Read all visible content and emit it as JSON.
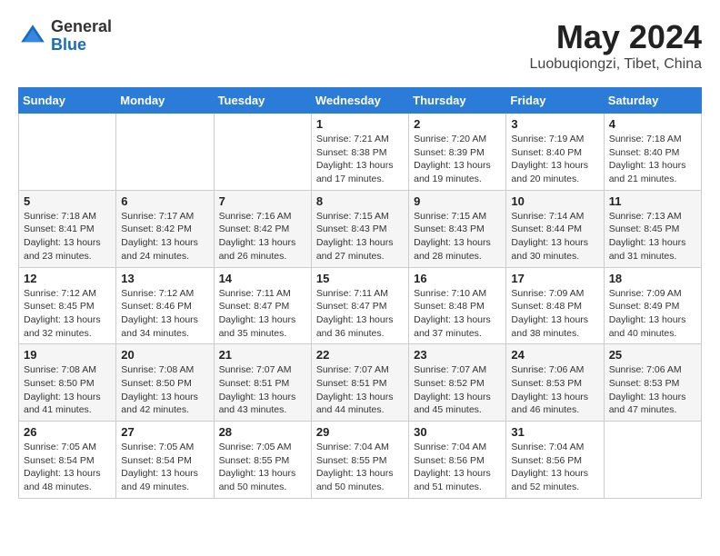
{
  "header": {
    "logo_general": "General",
    "logo_blue": "Blue",
    "month_year": "May 2024",
    "location": "Luobuqiongzi, Tibet, China"
  },
  "weekdays": [
    "Sunday",
    "Monday",
    "Tuesday",
    "Wednesday",
    "Thursday",
    "Friday",
    "Saturday"
  ],
  "weeks": [
    [
      {
        "day": "",
        "info": ""
      },
      {
        "day": "",
        "info": ""
      },
      {
        "day": "",
        "info": ""
      },
      {
        "day": "1",
        "info": "Sunrise: 7:21 AM\nSunset: 8:38 PM\nDaylight: 13 hours\nand 17 minutes."
      },
      {
        "day": "2",
        "info": "Sunrise: 7:20 AM\nSunset: 8:39 PM\nDaylight: 13 hours\nand 19 minutes."
      },
      {
        "day": "3",
        "info": "Sunrise: 7:19 AM\nSunset: 8:40 PM\nDaylight: 13 hours\nand 20 minutes."
      },
      {
        "day": "4",
        "info": "Sunrise: 7:18 AM\nSunset: 8:40 PM\nDaylight: 13 hours\nand 21 minutes."
      }
    ],
    [
      {
        "day": "5",
        "info": "Sunrise: 7:18 AM\nSunset: 8:41 PM\nDaylight: 13 hours\nand 23 minutes."
      },
      {
        "day": "6",
        "info": "Sunrise: 7:17 AM\nSunset: 8:42 PM\nDaylight: 13 hours\nand 24 minutes."
      },
      {
        "day": "7",
        "info": "Sunrise: 7:16 AM\nSunset: 8:42 PM\nDaylight: 13 hours\nand 26 minutes."
      },
      {
        "day": "8",
        "info": "Sunrise: 7:15 AM\nSunset: 8:43 PM\nDaylight: 13 hours\nand 27 minutes."
      },
      {
        "day": "9",
        "info": "Sunrise: 7:15 AM\nSunset: 8:43 PM\nDaylight: 13 hours\nand 28 minutes."
      },
      {
        "day": "10",
        "info": "Sunrise: 7:14 AM\nSunset: 8:44 PM\nDaylight: 13 hours\nand 30 minutes."
      },
      {
        "day": "11",
        "info": "Sunrise: 7:13 AM\nSunset: 8:45 PM\nDaylight: 13 hours\nand 31 minutes."
      }
    ],
    [
      {
        "day": "12",
        "info": "Sunrise: 7:12 AM\nSunset: 8:45 PM\nDaylight: 13 hours\nand 32 minutes."
      },
      {
        "day": "13",
        "info": "Sunrise: 7:12 AM\nSunset: 8:46 PM\nDaylight: 13 hours\nand 34 minutes."
      },
      {
        "day": "14",
        "info": "Sunrise: 7:11 AM\nSunset: 8:47 PM\nDaylight: 13 hours\nand 35 minutes."
      },
      {
        "day": "15",
        "info": "Sunrise: 7:11 AM\nSunset: 8:47 PM\nDaylight: 13 hours\nand 36 minutes."
      },
      {
        "day": "16",
        "info": "Sunrise: 7:10 AM\nSunset: 8:48 PM\nDaylight: 13 hours\nand 37 minutes."
      },
      {
        "day": "17",
        "info": "Sunrise: 7:09 AM\nSunset: 8:48 PM\nDaylight: 13 hours\nand 38 minutes."
      },
      {
        "day": "18",
        "info": "Sunrise: 7:09 AM\nSunset: 8:49 PM\nDaylight: 13 hours\nand 40 minutes."
      }
    ],
    [
      {
        "day": "19",
        "info": "Sunrise: 7:08 AM\nSunset: 8:50 PM\nDaylight: 13 hours\nand 41 minutes."
      },
      {
        "day": "20",
        "info": "Sunrise: 7:08 AM\nSunset: 8:50 PM\nDaylight: 13 hours\nand 42 minutes."
      },
      {
        "day": "21",
        "info": "Sunrise: 7:07 AM\nSunset: 8:51 PM\nDaylight: 13 hours\nand 43 minutes."
      },
      {
        "day": "22",
        "info": "Sunrise: 7:07 AM\nSunset: 8:51 PM\nDaylight: 13 hours\nand 44 minutes."
      },
      {
        "day": "23",
        "info": "Sunrise: 7:07 AM\nSunset: 8:52 PM\nDaylight: 13 hours\nand 45 minutes."
      },
      {
        "day": "24",
        "info": "Sunrise: 7:06 AM\nSunset: 8:53 PM\nDaylight: 13 hours\nand 46 minutes."
      },
      {
        "day": "25",
        "info": "Sunrise: 7:06 AM\nSunset: 8:53 PM\nDaylight: 13 hours\nand 47 minutes."
      }
    ],
    [
      {
        "day": "26",
        "info": "Sunrise: 7:05 AM\nSunset: 8:54 PM\nDaylight: 13 hours\nand 48 minutes."
      },
      {
        "day": "27",
        "info": "Sunrise: 7:05 AM\nSunset: 8:54 PM\nDaylight: 13 hours\nand 49 minutes."
      },
      {
        "day": "28",
        "info": "Sunrise: 7:05 AM\nSunset: 8:55 PM\nDaylight: 13 hours\nand 50 minutes."
      },
      {
        "day": "29",
        "info": "Sunrise: 7:04 AM\nSunset: 8:55 PM\nDaylight: 13 hours\nand 50 minutes."
      },
      {
        "day": "30",
        "info": "Sunrise: 7:04 AM\nSunset: 8:56 PM\nDaylight: 13 hours\nand 51 minutes."
      },
      {
        "day": "31",
        "info": "Sunrise: 7:04 AM\nSunset: 8:56 PM\nDaylight: 13 hours\nand 52 minutes."
      },
      {
        "day": "",
        "info": ""
      }
    ]
  ]
}
